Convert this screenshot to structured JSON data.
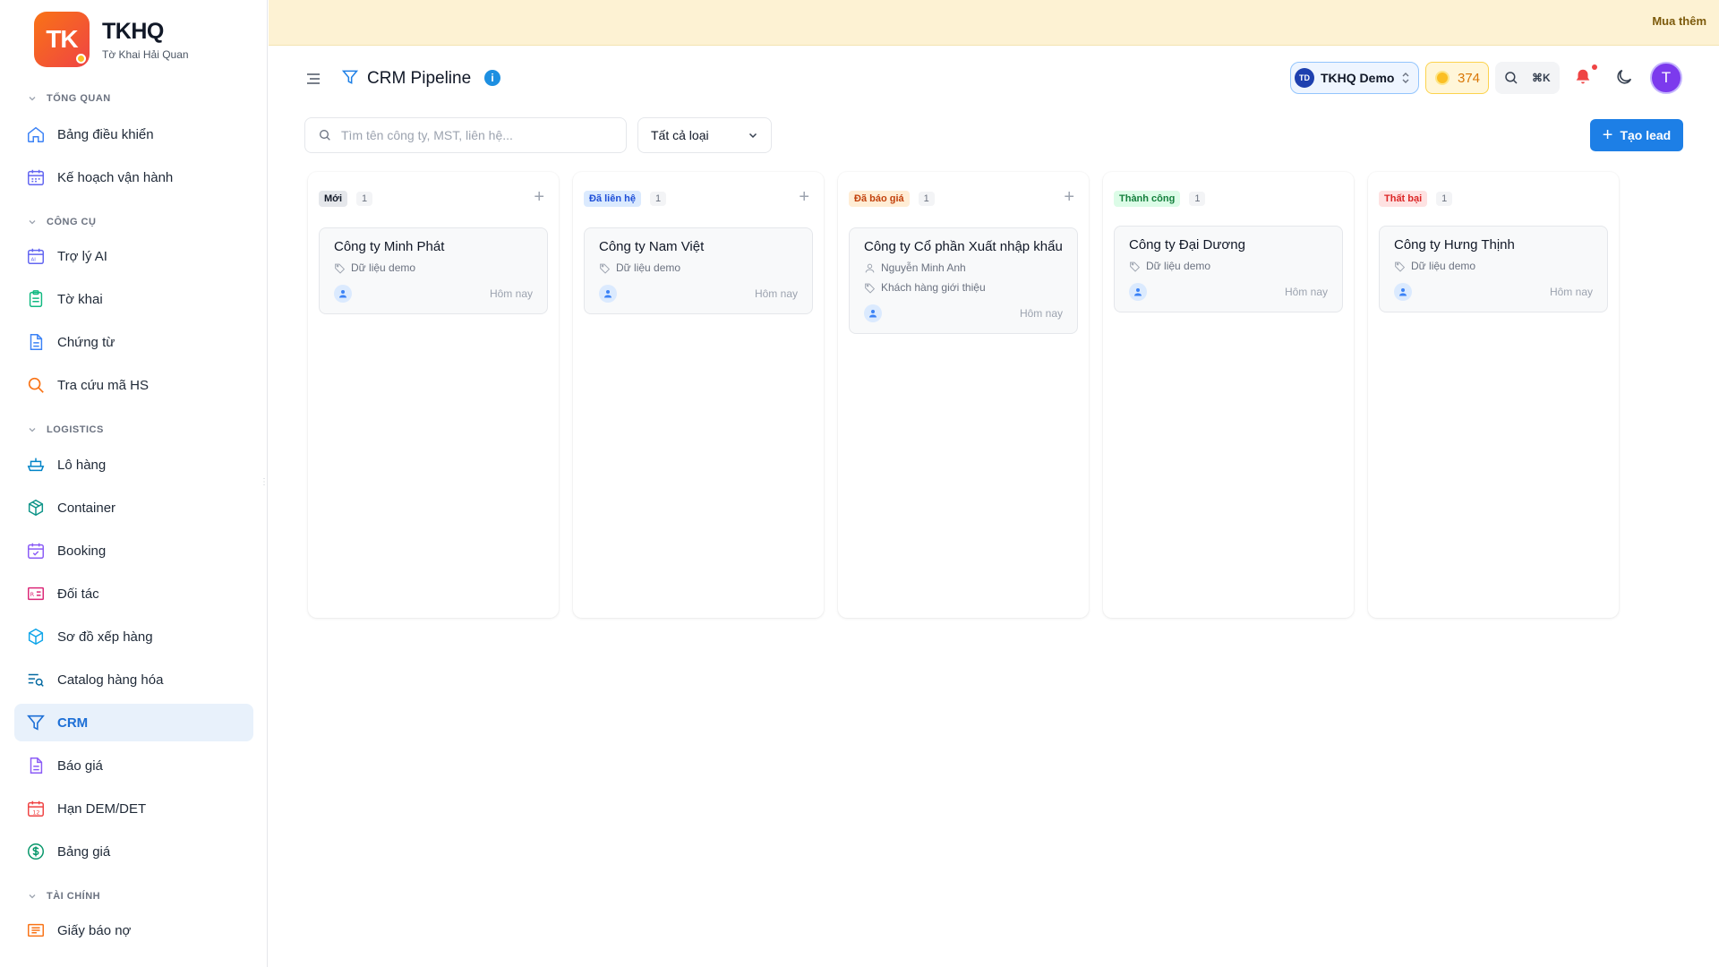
{
  "brand": {
    "logo_text": "TK",
    "name": "TKHQ",
    "subtitle": "Tờ Khai Hải Quan"
  },
  "sidebar": {
    "sections": [
      {
        "label": "TỔNG QUAN"
      },
      {
        "label": "CÔNG CỤ"
      },
      {
        "label": "LOGISTICS"
      },
      {
        "label": "TÀI CHÍNH"
      }
    ],
    "items": [
      {
        "label": "Bảng điều khiển",
        "icon": "home-icon"
      },
      {
        "label": "Kế hoạch vận hành",
        "icon": "calendar-icon"
      },
      {
        "label": "Trợ lý AI",
        "icon": "ai-icon"
      },
      {
        "label": "Tờ khai",
        "icon": "clipboard-icon"
      },
      {
        "label": "Chứng từ",
        "icon": "document-icon"
      },
      {
        "label": "Tra cứu mã HS",
        "icon": "search-icon"
      },
      {
        "label": "Lô hàng",
        "icon": "ship-icon"
      },
      {
        "label": "Container",
        "icon": "box-icon"
      },
      {
        "label": "Booking",
        "icon": "calendar-check-icon"
      },
      {
        "label": "Đối tác",
        "icon": "contact-card-icon"
      },
      {
        "label": "Sơ đồ xếp hàng",
        "icon": "cube-icon"
      },
      {
        "label": "Catalog hàng hóa",
        "icon": "list-search-icon"
      },
      {
        "label": "CRM",
        "icon": "filter-icon",
        "active": true
      },
      {
        "label": "Báo giá",
        "icon": "file-icon"
      },
      {
        "label": "Hạn DEM/DET",
        "icon": "calendar-12-icon"
      },
      {
        "label": "Bảng giá",
        "icon": "dollar-icon"
      },
      {
        "label": "Giấy báo nợ",
        "icon": "receipt-icon"
      }
    ]
  },
  "topbar": {
    "buy_more": "Mua thêm"
  },
  "header": {
    "title": "CRM Pipeline",
    "info": "i",
    "workspace": {
      "badge": "TD",
      "name": "TKHQ Demo"
    },
    "coins": "374",
    "shortcut": "⌘K",
    "avatar_letter": "T"
  },
  "toolbar": {
    "search_placeholder": "Tìm tên công ty, MST, liên hệ...",
    "type_filter": "Tất cả loại",
    "create_lead": "Tạo lead"
  },
  "colors": {
    "accent": "#1d7fe6",
    "stage_new_bg": "#e5e7eb",
    "stage_new_fg": "#111827",
    "stage_contacted_bg": "#dbeafe",
    "stage_contacted_fg": "#1d4ed8",
    "stage_quoted_bg": "#ffedd5",
    "stage_quoted_fg": "#c2410c",
    "stage_won_bg": "#dcfce7",
    "stage_won_fg": "#15803d",
    "stage_lost_bg": "#fee2e2",
    "stage_lost_fg": "#dc2626"
  },
  "pipeline": {
    "columns": [
      {
        "stage": "Mới",
        "count": "1",
        "cards": [
          {
            "company": "Công ty Minh Phát",
            "source": "Dữ liệu demo",
            "date": "Hôm nay"
          }
        ]
      },
      {
        "stage": "Đã liên hệ",
        "count": "1",
        "cards": [
          {
            "company": "Công ty Nam Việt",
            "source": "Dữ liệu demo",
            "date": "Hôm nay"
          }
        ]
      },
      {
        "stage": "Đã báo giá",
        "count": "1",
        "cards": [
          {
            "company": "Công ty Cổ phần Xuất nhập khẩu",
            "contact": "Nguyễn Minh Anh",
            "source": "Khách hàng giới thiệu",
            "date": "Hôm nay"
          }
        ]
      },
      {
        "stage": "Thành công",
        "count": "1",
        "cards": [
          {
            "company": "Công ty Đại Dương",
            "source": "Dữ liệu demo",
            "date": "Hôm nay"
          }
        ]
      },
      {
        "stage": "Thất bại",
        "count": "1",
        "cards": [
          {
            "company": "Công ty Hưng Thịnh",
            "source": "Dữ liệu demo",
            "date": "Hôm nay"
          }
        ]
      }
    ]
  }
}
